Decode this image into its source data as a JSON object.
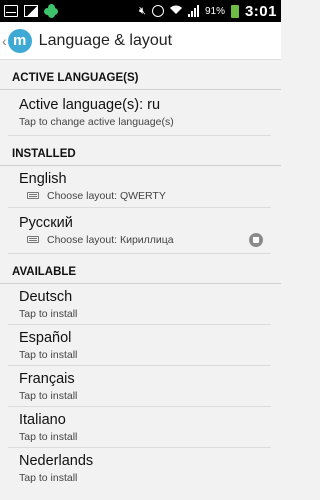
{
  "status_bar": {
    "battery_percent": "91%",
    "time": "3:01"
  },
  "action_bar": {
    "back_glyph": "‹",
    "logo_letter": "m",
    "title": "Language & layout"
  },
  "sections": {
    "active": {
      "header": "ACTIVE LANGUAGE(S)",
      "title": "Active language(s): ru",
      "subtitle": "Tap to change active language(s)"
    },
    "installed": {
      "header": "INSTALLED",
      "items": [
        {
          "title": "English",
          "subtitle": "Choose layout: QWERTY"
        },
        {
          "title": "Русский",
          "subtitle": "Choose layout: Кириллица"
        }
      ]
    },
    "available": {
      "header": "AVAILABLE",
      "items": [
        {
          "title": "Deutsch",
          "subtitle": "Tap to install"
        },
        {
          "title": "Español",
          "subtitle": "Tap to install"
        },
        {
          "title": "Français",
          "subtitle": "Tap to install"
        },
        {
          "title": "Italiano",
          "subtitle": "Tap to install"
        },
        {
          "title": "Nederlands",
          "subtitle": "Tap to install"
        }
      ]
    }
  },
  "colors": {
    "accent": "#3fa9d6",
    "battery": "#6dbd45",
    "notification_clover": "#3cc36b"
  },
  "icons": [
    "email-icon",
    "gallery-icon",
    "clover-icon",
    "mute-icon",
    "alarm-icon",
    "wifi-icon",
    "signal-icon",
    "battery-icon",
    "keyboard-icon",
    "trash-icon"
  ]
}
